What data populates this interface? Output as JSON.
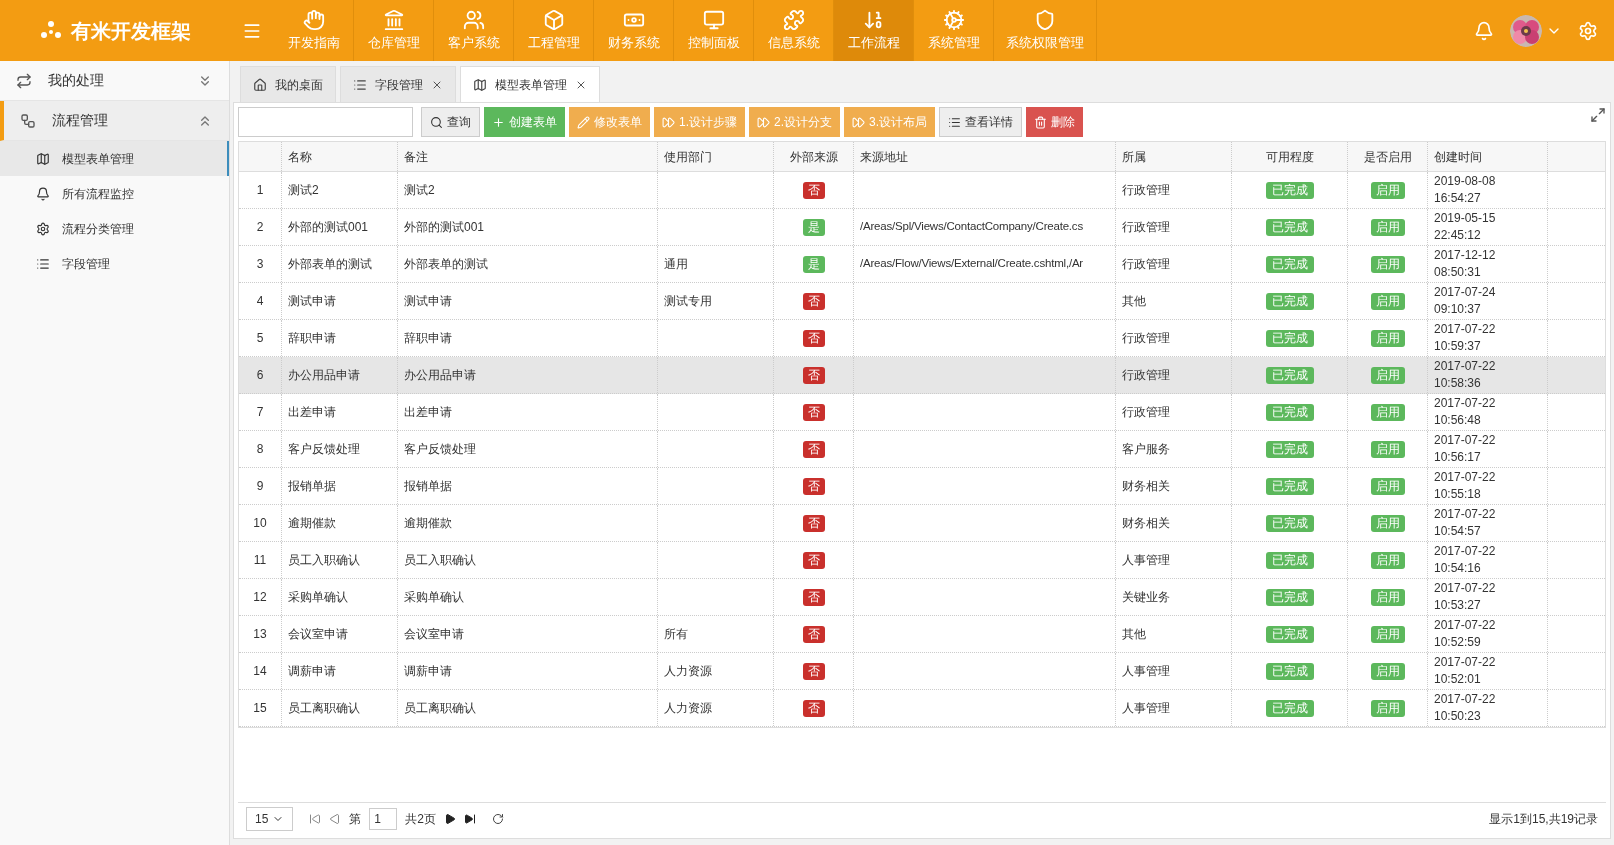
{
  "brand": "有米开发框架",
  "nav": [
    {
      "label": "开发指南",
      "selected": false
    },
    {
      "label": "仓库管理",
      "selected": false
    },
    {
      "label": "客户系统",
      "selected": false
    },
    {
      "label": "工程管理",
      "selected": false
    },
    {
      "label": "财务系统",
      "selected": false
    },
    {
      "label": "控制面板",
      "selected": false
    },
    {
      "label": "信息系统",
      "selected": false
    },
    {
      "label": "工作流程",
      "selected": true
    },
    {
      "label": "系统管理",
      "selected": false
    },
    {
      "label": "系统权限管理",
      "selected": false
    }
  ],
  "sidebar": {
    "groups": [
      {
        "label": "我的处理",
        "expanded": false
      },
      {
        "label": "流程管理",
        "expanded": true,
        "children": [
          {
            "label": "模型表单管理",
            "selected": true
          },
          {
            "label": "所有流程监控",
            "selected": false
          },
          {
            "label": "流程分类管理",
            "selected": false
          },
          {
            "label": "字段管理",
            "selected": false
          }
        ]
      }
    ]
  },
  "tabs": [
    {
      "label": "我的桌面",
      "closable": false,
      "selected": false
    },
    {
      "label": "字段管理",
      "closable": true,
      "selected": false
    },
    {
      "label": "模型表单管理",
      "closable": true,
      "selected": true
    }
  ],
  "toolbar": {
    "search_button": "查询",
    "buttons": [
      {
        "label": "创建表单",
        "kind": "create"
      },
      {
        "label": "修改表单",
        "kind": "edit"
      },
      {
        "label": "1.设计步骤",
        "kind": "step"
      },
      {
        "label": "2.设计分支",
        "kind": "step"
      },
      {
        "label": "3.设计布局",
        "kind": "step"
      },
      {
        "label": "查看详情",
        "kind": "view"
      },
      {
        "label": "删除",
        "kind": "delete"
      }
    ]
  },
  "table": {
    "columns": [
      "名称",
      "备注",
      "使用部门",
      "外部来源",
      "来源地址",
      "所属",
      "可用程度",
      "是否启用",
      "创建时间"
    ],
    "rows": [
      {
        "index": "1",
        "name": "测试2",
        "remark": "测试2",
        "external": "否",
        "external_yes": false,
        "belong": "行政管理",
        "status": "已完成",
        "enabled": "启用",
        "date": "2019-08-08",
        "time": "16:54:27",
        "selected": false
      },
      {
        "index": "2",
        "name": "外部的测试001",
        "remark": "外部的测试001",
        "external": "是",
        "external_yes": true,
        "source": "/Areas/Spl/Views/ContactCompany/Create.cs",
        "belong": "行政管理",
        "status": "已完成",
        "enabled": "启用",
        "date": "2019-05-15",
        "time": "22:45:12",
        "selected": false
      },
      {
        "index": "3",
        "name": "外部表单的测试",
        "remark": "外部表单的测试",
        "dept": "通用",
        "external": "是",
        "external_yes": true,
        "source": "/Areas/Flow/Views/External/Create.cshtml,/Ar",
        "belong": "行政管理",
        "status": "已完成",
        "enabled": "启用",
        "date": "2017-12-12",
        "time": "08:50:31",
        "selected": false
      },
      {
        "index": "4",
        "name": "测试申请",
        "remark": "测试申请",
        "dept": "测试专用",
        "external": "否",
        "external_yes": false,
        "belong": "其他",
        "status": "已完成",
        "enabled": "启用",
        "date": "2017-07-24",
        "time": "09:10:37",
        "selected": false
      },
      {
        "index": "5",
        "name": "辞职申请",
        "remark": "辞职申请",
        "external": "否",
        "external_yes": false,
        "belong": "行政管理",
        "status": "已完成",
        "enabled": "启用",
        "date": "2017-07-22",
        "time": "10:59:37",
        "selected": false
      },
      {
        "index": "6",
        "name": "办公用品申请",
        "remark": "办公用品申请",
        "external": "否",
        "external_yes": false,
        "belong": "行政管理",
        "status": "已完成",
        "enabled": "启用",
        "date": "2017-07-22",
        "time": "10:58:36",
        "selected": true
      },
      {
        "index": "7",
        "name": "出差申请",
        "remark": "出差申请",
        "external": "否",
        "external_yes": false,
        "belong": "行政管理",
        "status": "已完成",
        "enabled": "启用",
        "date": "2017-07-22",
        "time": "10:56:48",
        "selected": false
      },
      {
        "index": "8",
        "name": "客户反馈处理",
        "remark": "客户反馈处理",
        "external": "否",
        "external_yes": false,
        "belong": "客户服务",
        "status": "已完成",
        "enabled": "启用",
        "date": "2017-07-22",
        "time": "10:56:17",
        "selected": false
      },
      {
        "index": "9",
        "name": "报销单据",
        "remark": "报销单据",
        "external": "否",
        "external_yes": false,
        "belong": "财务相关",
        "status": "已完成",
        "enabled": "启用",
        "date": "2017-07-22",
        "time": "10:55:18",
        "selected": false
      },
      {
        "index": "10",
        "name": "逾期催款",
        "remark": "逾期催款",
        "external": "否",
        "external_yes": false,
        "belong": "财务相关",
        "status": "已完成",
        "enabled": "启用",
        "date": "2017-07-22",
        "time": "10:54:57",
        "selected": false
      },
      {
        "index": "11",
        "name": "员工入职确认",
        "remark": "员工入职确认",
        "external": "否",
        "external_yes": false,
        "belong": "人事管理",
        "status": "已完成",
        "enabled": "启用",
        "date": "2017-07-22",
        "time": "10:54:16",
        "selected": false
      },
      {
        "index": "12",
        "name": "采购单确认",
        "remark": "采购单确认",
        "external": "否",
        "external_yes": false,
        "belong": "关键业务",
        "status": "已完成",
        "enabled": "启用",
        "date": "2017-07-22",
        "time": "10:53:27",
        "selected": false
      },
      {
        "index": "13",
        "name": "会议室申请",
        "remark": "会议室申请",
        "dept": "所有",
        "external": "否",
        "external_yes": false,
        "belong": "其他",
        "status": "已完成",
        "enabled": "启用",
        "date": "2017-07-22",
        "time": "10:52:59",
        "selected": false
      },
      {
        "index": "14",
        "name": "调薪申请",
        "remark": "调薪申请",
        "dept": "人力资源",
        "external": "否",
        "external_yes": false,
        "belong": "人事管理",
        "status": "已完成",
        "enabled": "启用",
        "date": "2017-07-22",
        "time": "10:52:01",
        "selected": false
      },
      {
        "index": "15",
        "name": "员工离职确认",
        "remark": "员工离职确认",
        "dept": "人力资源",
        "external": "否",
        "external_yes": false,
        "belong": "人事管理",
        "status": "已完成",
        "enabled": "启用",
        "date": "2017-07-22",
        "time": "10:50:23",
        "selected": false
      }
    ]
  },
  "pager": {
    "page_size": "15",
    "page_prefix": "第",
    "page": "1",
    "total_pages": "共2页",
    "summary": "显示1到15,共19记录"
  }
}
